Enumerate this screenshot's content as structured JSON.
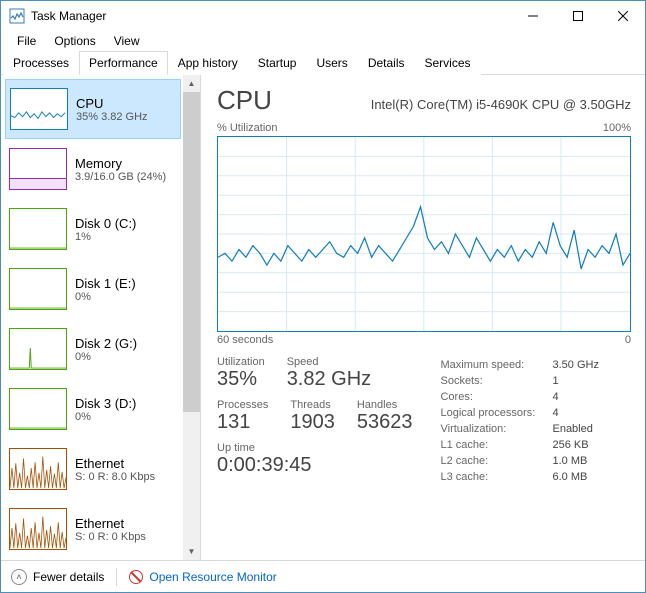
{
  "window": {
    "title": "Task Manager"
  },
  "menu": [
    "File",
    "Options",
    "View"
  ],
  "tabs": [
    "Processes",
    "Performance",
    "App history",
    "Startup",
    "Users",
    "Details",
    "Services"
  ],
  "active_tab": 1,
  "sidebar": [
    {
      "name": "CPU",
      "sub": "35% 3.82 GHz",
      "kind": "cpu",
      "selected": true
    },
    {
      "name": "Memory",
      "sub": "3.9/16.0 GB (24%)",
      "kind": "mem"
    },
    {
      "name": "Disk 0 (C:)",
      "sub": "1%",
      "kind": "disk"
    },
    {
      "name": "Disk 1 (E:)",
      "sub": "0%",
      "kind": "disk"
    },
    {
      "name": "Disk 2 (G:)",
      "sub": "0%",
      "kind": "disk"
    },
    {
      "name": "Disk 3 (D:)",
      "sub": "0%",
      "kind": "disk"
    },
    {
      "name": "Ethernet",
      "sub": "S: 0 R: 8.0 Kbps",
      "kind": "eth"
    },
    {
      "name": "Ethernet",
      "sub": "S: 0 R: 0 Kbps",
      "kind": "eth"
    }
  ],
  "detail": {
    "title": "CPU",
    "subtitle": "Intel(R) Core(TM) i5-4690K CPU @ 3.50GHz",
    "chart_top_left": "% Utilization",
    "chart_top_right": "100%",
    "chart_bottom_left": "60 seconds",
    "chart_bottom_right": "0",
    "stats_left": [
      [
        {
          "label": "Utilization",
          "value": "35%"
        },
        {
          "label": "Speed",
          "value": "3.82 GHz"
        }
      ],
      [
        {
          "label": "Processes",
          "value": "131"
        },
        {
          "label": "Threads",
          "value": "1903"
        },
        {
          "label": "Handles",
          "value": "53623"
        }
      ]
    ],
    "uptime_label": "Up time",
    "uptime_value": "0:00:39:45",
    "stats_right": [
      [
        "Maximum speed:",
        "3.50 GHz"
      ],
      [
        "Sockets:",
        "1"
      ],
      [
        "Cores:",
        "4"
      ],
      [
        "Logical processors:",
        "4"
      ],
      [
        "Virtualization:",
        "Enabled"
      ],
      [
        "L1 cache:",
        "256 KB"
      ],
      [
        "L2 cache:",
        "1.0 MB"
      ],
      [
        "L3 cache:",
        "6.0 MB"
      ]
    ]
  },
  "footer": {
    "fewer": "Fewer details",
    "resmon": "Open Resource Monitor"
  },
  "chart_data": {
    "type": "line",
    "title": "% Utilization",
    "xlabel": "60 seconds",
    "ylabel": "% Utilization",
    "ylim": [
      0,
      100
    ],
    "x_range_seconds": [
      60,
      0
    ],
    "series": [
      {
        "name": "CPU",
        "color": "#117dbb",
        "values": [
          38,
          40,
          36,
          42,
          38,
          44,
          40,
          34,
          40,
          36,
          44,
          40,
          36,
          42,
          38,
          42,
          46,
          40,
          38,
          44,
          40,
          48,
          38,
          44,
          40,
          36,
          42,
          48,
          54,
          64,
          48,
          42,
          46,
          40,
          50,
          44,
          38,
          48,
          42,
          36,
          42,
          38,
          44,
          36,
          42,
          38,
          46,
          40,
          56,
          44,
          38,
          52,
          32,
          42,
          38,
          44,
          40,
          50,
          34,
          40
        ]
      }
    ]
  }
}
